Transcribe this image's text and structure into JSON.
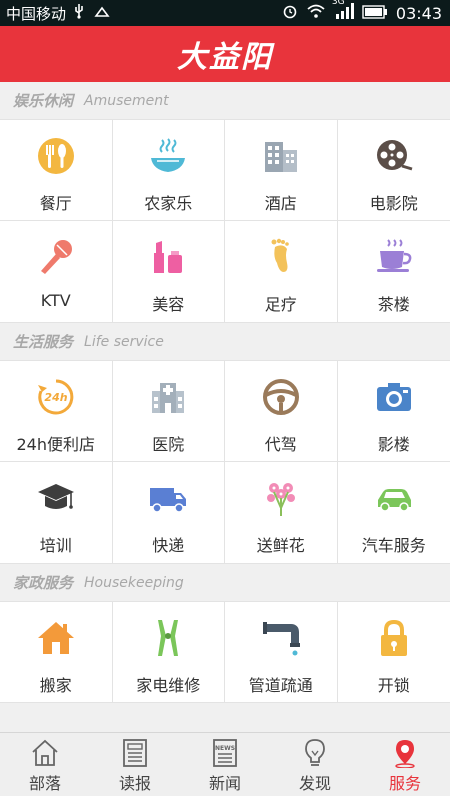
{
  "status_bar": {
    "carrier": "中国移动",
    "signal_badge": "3G",
    "time": "03:43"
  },
  "header": {
    "brand": "大益阳"
  },
  "sections": [
    {
      "title": "娱乐休闲",
      "subtitle": "Amusement",
      "items": [
        {
          "label": "餐厅",
          "icon": "restaurant-icon"
        },
        {
          "label": "农家乐",
          "icon": "farmhouse-icon"
        },
        {
          "label": "酒店",
          "icon": "hotel-icon"
        },
        {
          "label": "电影院",
          "icon": "cinema-icon"
        },
        {
          "label": "KTV",
          "icon": "microphone-icon"
        },
        {
          "label": "美容",
          "icon": "beauty-icon"
        },
        {
          "label": "足疗",
          "icon": "foot-icon"
        },
        {
          "label": "茶楼",
          "icon": "tea-cup-icon"
        }
      ]
    },
    {
      "title": "生活服务",
      "subtitle": "Life service",
      "items": [
        {
          "label": "24h便利店",
          "icon": "store-24h-icon",
          "badge": "24h"
        },
        {
          "label": "医院",
          "icon": "hospital-icon"
        },
        {
          "label": "代驾",
          "icon": "steering-wheel-icon"
        },
        {
          "label": "影楼",
          "icon": "camera-icon"
        },
        {
          "label": "培训",
          "icon": "graduation-cap-icon"
        },
        {
          "label": "快递",
          "icon": "truck-icon"
        },
        {
          "label": "送鲜花",
          "icon": "flower-icon"
        },
        {
          "label": "汽车服务",
          "icon": "car-icon"
        }
      ]
    },
    {
      "title": "家政服务",
      "subtitle": "Housekeeping",
      "items": [
        {
          "label": "搬家",
          "icon": "house-icon"
        },
        {
          "label": "家电维修",
          "icon": "pliers-icon"
        },
        {
          "label": "管道疏通",
          "icon": "pipe-icon"
        },
        {
          "label": "开锁",
          "icon": "lock-icon"
        }
      ]
    }
  ],
  "bottom_nav": [
    {
      "label": "部落",
      "icon": "tribe-icon",
      "active": false
    },
    {
      "label": "读报",
      "icon": "newspaper-icon",
      "active": false
    },
    {
      "label": "新闻",
      "icon": "news-icon",
      "news_tag": "NEWS",
      "active": false
    },
    {
      "label": "发现",
      "icon": "lightbulb-icon",
      "active": false
    },
    {
      "label": "服务",
      "icon": "location-pin-icon",
      "active": true
    }
  ],
  "colors": {
    "accent": "#e8343c",
    "status_bar": "#0c1a1b",
    "section_text": "#a8a8a8"
  }
}
